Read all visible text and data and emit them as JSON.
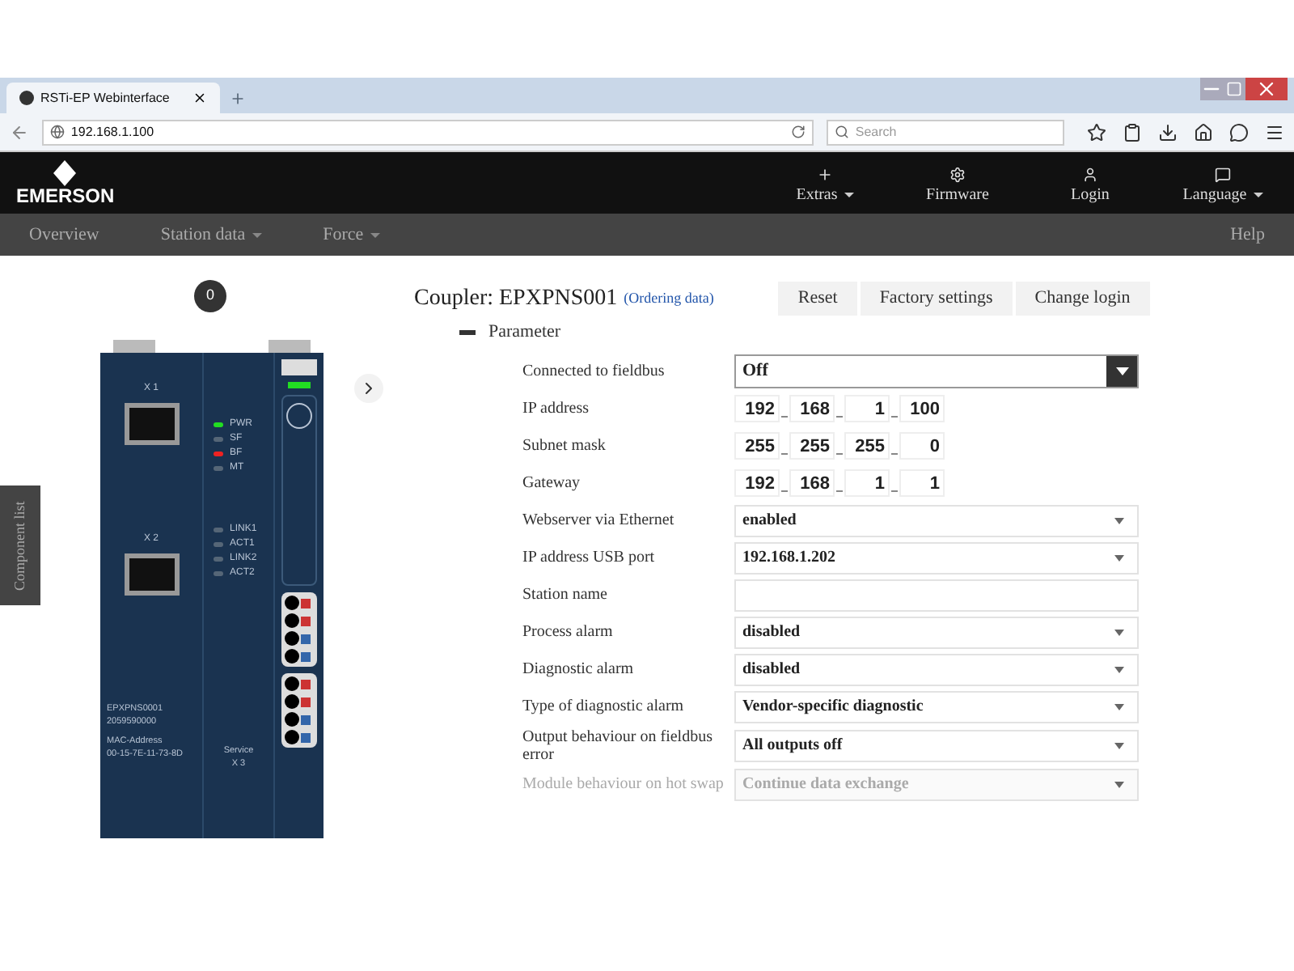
{
  "browser": {
    "tab_title": "RSTi-EP Webinterface",
    "url": "192.168.1.100",
    "search_placeholder": "Search"
  },
  "header": {
    "logo": "EMERSON",
    "menu": [
      {
        "label": "Extras",
        "dropdown": true
      },
      {
        "label": "Firmware",
        "dropdown": false
      },
      {
        "label": "Login",
        "dropdown": false
      },
      {
        "label": "Language",
        "dropdown": true
      }
    ]
  },
  "nav": {
    "items": [
      {
        "label": "Overview",
        "dropdown": false
      },
      {
        "label": "Station data",
        "dropdown": true
      },
      {
        "label": "Force",
        "dropdown": true
      }
    ],
    "help": "Help"
  },
  "side_tab": "Component list",
  "badge": "0",
  "device": {
    "ports": [
      "X 1",
      "X 2"
    ],
    "leds": [
      {
        "label": "PWR",
        "color": "#22dd22"
      },
      {
        "label": "SF",
        "color": "#556677"
      },
      {
        "label": "BF",
        "color": "#ee2222"
      },
      {
        "label": "MT",
        "color": "#556677"
      }
    ],
    "link_leds": [
      {
        "label": "LINK1",
        "color": "#556677"
      },
      {
        "label": "ACT1",
        "color": "#556677"
      },
      {
        "label": "LINK2",
        "color": "#556677"
      },
      {
        "label": "ACT2",
        "color": "#556677"
      }
    ],
    "info": [
      "EPXPNS0001",
      "2059590000"
    ],
    "mac_label": "MAC-Address",
    "mac": "00-15-7E-11-73-8D",
    "service": "Service",
    "service_port": "X 3"
  },
  "title": "Coupler: EPXPNS001",
  "ordering_link": "(Ordering data)",
  "buttons": [
    "Reset",
    "Factory settings",
    "Change login"
  ],
  "section": {
    "label": "Parameter",
    "expanded": true
  },
  "params": [
    {
      "label": "Connected to fieldbus",
      "kind": "select_dark",
      "value": "Off",
      "disabled": false
    },
    {
      "label": "IP address",
      "kind": "ip",
      "octets": [
        "192",
        "168",
        "1",
        "100"
      ],
      "disabled": false
    },
    {
      "label": "Subnet mask",
      "kind": "ip",
      "octets": [
        "255",
        "255",
        "255",
        "0"
      ],
      "disabled": false
    },
    {
      "label": "Gateway",
      "kind": "ip",
      "octets": [
        "192",
        "168",
        "1",
        "1"
      ],
      "disabled": false
    },
    {
      "label": "Webserver via Ethernet",
      "kind": "select",
      "value": "enabled",
      "disabled": false
    },
    {
      "label": "IP address USB port",
      "kind": "select",
      "value": "192.168.1.202",
      "disabled": false
    },
    {
      "label": "Station name",
      "kind": "text",
      "disabled": false
    },
    {
      "label": "Process alarm",
      "kind": "select",
      "value": "disabled",
      "disabled": false
    },
    {
      "label": "Diagnostic alarm",
      "kind": "select",
      "value": "disabled",
      "disabled": false
    },
    {
      "label": "Type of diagnostic alarm",
      "kind": "select",
      "value": "Vendor-specific diagnostic",
      "disabled": false
    },
    {
      "label": "Output behaviour on fieldbus error",
      "kind": "select",
      "value": "All outputs off",
      "disabled": false
    },
    {
      "label": "Module behaviour on hot swap",
      "kind": "select",
      "value": "Continue data exchange",
      "disabled": true
    }
  ]
}
